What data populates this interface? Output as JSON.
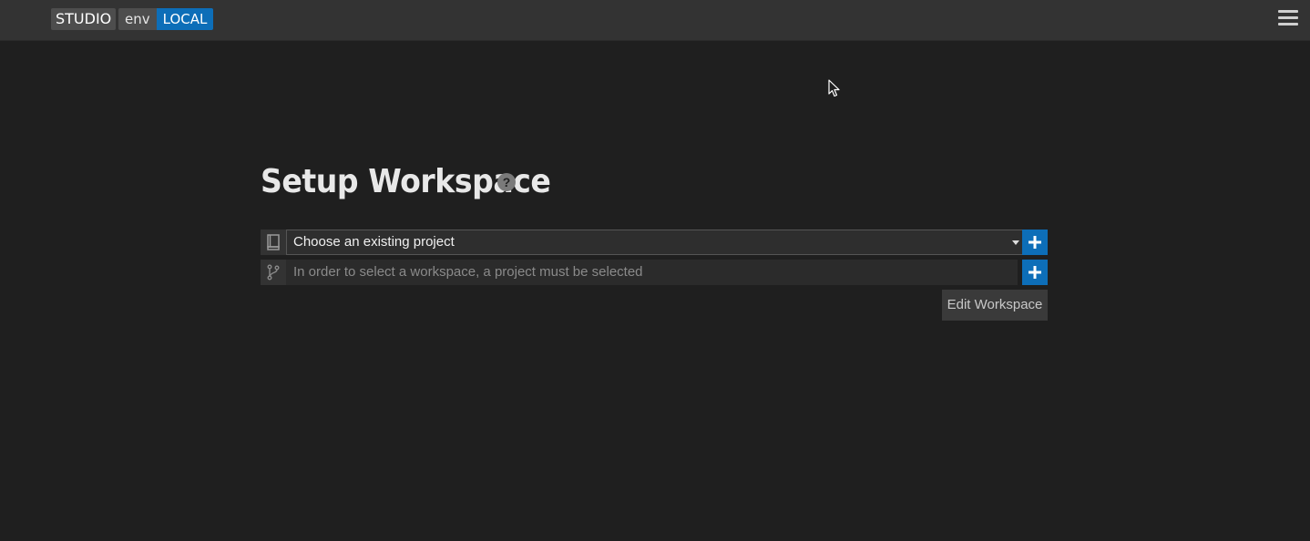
{
  "header": {
    "brand": "STUDIO",
    "env_key": "env",
    "env_value": "LOCAL",
    "menu_icon": "hamburger-menu-icon"
  },
  "main": {
    "title": "Setup Workspace",
    "help_icon": "question-circle-icon",
    "project_select": {
      "icon": "book-icon",
      "value": "Choose an existing project"
    },
    "workspace_input": {
      "icon": "git-branch-icon",
      "placeholder": "In order to select a workspace, a project must be selected"
    },
    "add_icon": "plus-icon",
    "edit_button_label": "Edit Workspace"
  },
  "colors": {
    "background": "#1f1f1f",
    "topbar": "#333333",
    "accent": "#0d6eb8"
  }
}
